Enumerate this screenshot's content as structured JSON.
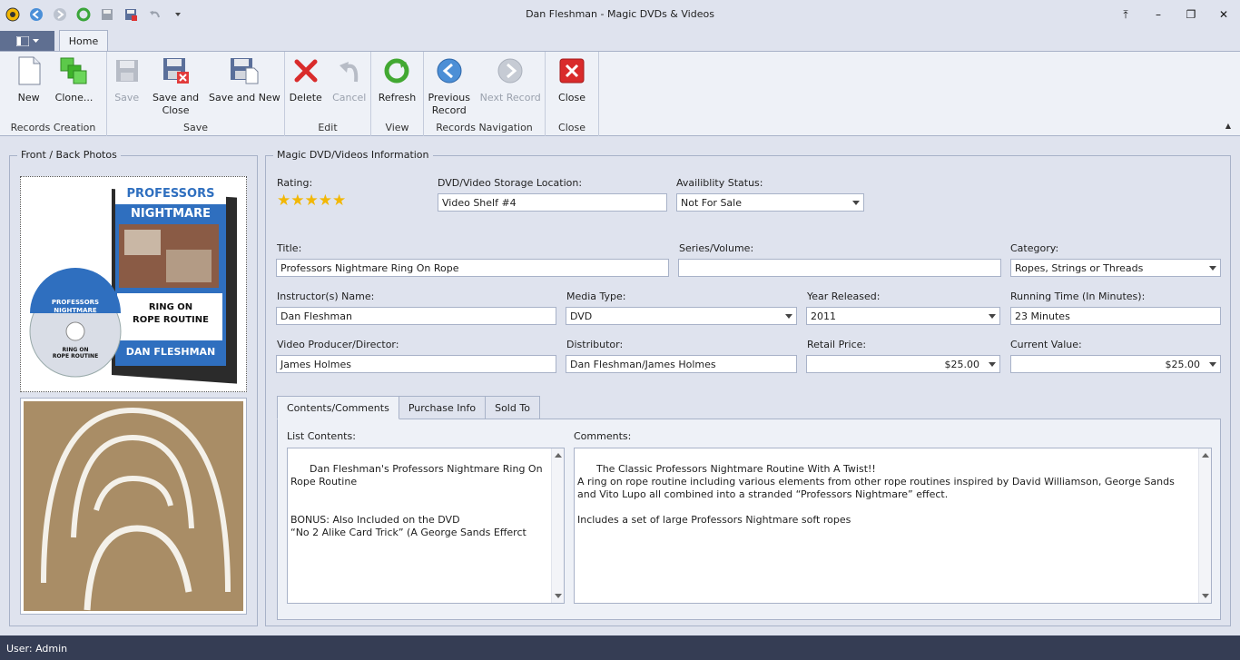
{
  "window": {
    "title": "Dan Fleshman - Magic DVDs & Videos",
    "buttons": [
      "⤒",
      "–",
      "❐",
      "✕"
    ]
  },
  "ribbon": {
    "home_tab": "Home",
    "groups": {
      "records_creation": {
        "label": "Records Creation",
        "new": "New",
        "clone": "Clone..."
      },
      "save": {
        "label": "Save",
        "save": "Save",
        "save_close": "Save and\nClose",
        "save_new": "Save and New"
      },
      "edit": {
        "label": "Edit",
        "delete": "Delete",
        "cancel": "Cancel"
      },
      "view": {
        "label": "View",
        "refresh": "Refresh"
      },
      "nav": {
        "label": "Records Navigation",
        "prev": "Previous\nRecord",
        "next": "Next Record"
      },
      "close": {
        "label": "Close",
        "close": "Close"
      }
    },
    "collapse_glyph": "▲"
  },
  "photos": {
    "title": "Front / Back Photos",
    "front_text": [
      "PROFESSORS",
      "NIGHTMARE",
      "RING ON",
      "ROPE ROUTINE",
      "DAN FLESHMAN"
    ]
  },
  "info": {
    "title": "Magic DVD/Videos Information",
    "rating_label": "Rating:",
    "rating": 5,
    "storage_label": "DVD/Video Storage Location:",
    "storage": "Video Shelf #4",
    "availability_label": "Availiblity Status:",
    "availability": "Not For Sale",
    "title_label": "Title:",
    "title_value": "Professors Nightmare Ring On Rope",
    "series_label": "Series/Volume:",
    "series": "",
    "category_label": "Category:",
    "category": "Ropes, Strings or Threads",
    "instructor_label": "Instructor(s) Name:",
    "instructor": "Dan Fleshman",
    "media_label": "Media Type:",
    "media": "DVD",
    "year_label": "Year Released:",
    "year": "2011",
    "runtime_label": "Running Time (In Minutes):",
    "runtime": "23 Minutes",
    "producer_label": "Video Producer/Director:",
    "producer": "James Holmes",
    "distributor_label": "Distributor:",
    "distributor": "Dan Fleshman/James Holmes",
    "retail_label": "Retail Price:",
    "retail": "$25.00",
    "current_label": "Current Value:",
    "current": "$25.00"
  },
  "tabs": [
    "Contents/Comments",
    "Purchase Info",
    "Sold To"
  ],
  "contents": {
    "list_label": "List Contents:",
    "list": "Dan Fleshman's Professors Nightmare Ring On Rope Routine\n\n\nBONUS: Also Included on the DVD\n“No 2 Alike Card Trick” (A George Sands Efferct",
    "comments_label": "Comments:",
    "comments": "The Classic Professors Nightmare Routine With A Twist!!\nA ring on rope routine including various elements from other rope routines inspired by David Williamson, George Sands and Vito Lupo all combined into a stranded “Professors Nightmare” effect.\n\nIncludes a set of large Professors Nightmare soft ropes"
  },
  "status": {
    "user": "User: Admin"
  }
}
